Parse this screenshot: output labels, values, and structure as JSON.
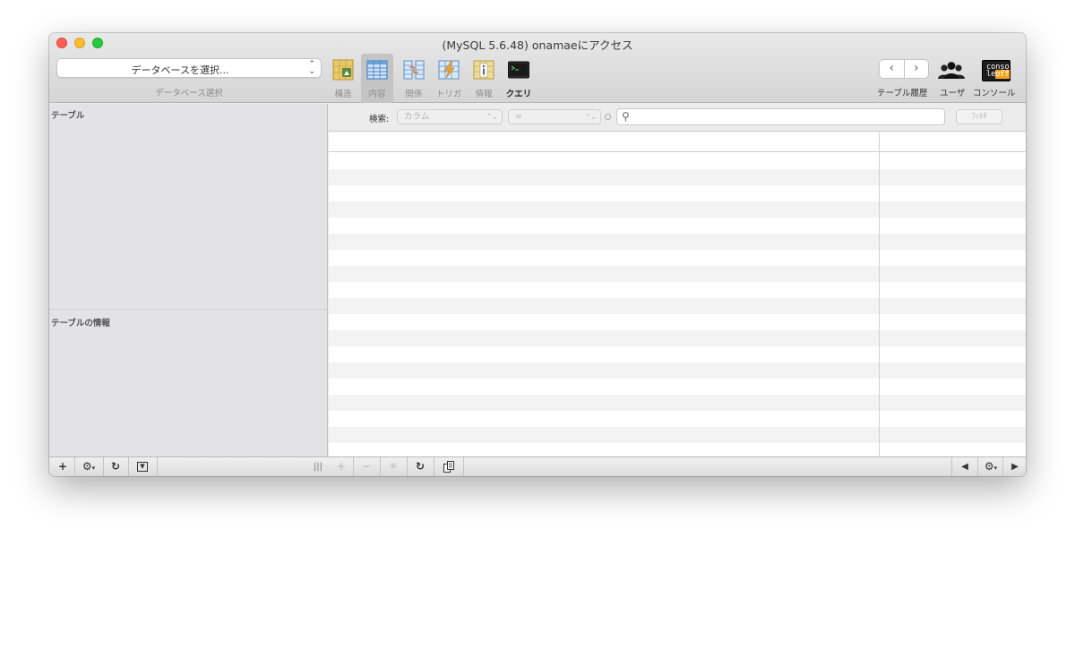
{
  "window": {
    "title": "(MySQL 5.6.48) onamaeにアクセス"
  },
  "toolbar": {
    "database_select_value": "データベースを選択...",
    "database_select_caption": "データベース選択",
    "buttons": [
      {
        "label": "構造",
        "icon": "structure-icon"
      },
      {
        "label": "内容",
        "icon": "content-table-icon",
        "active": true
      },
      {
        "label": "関係",
        "icon": "relations-icon"
      },
      {
        "label": "トリガ",
        "icon": "triggers-icon"
      },
      {
        "label": "情報",
        "icon": "info-icon"
      },
      {
        "label": "クエリ",
        "icon": "terminal-icon"
      }
    ],
    "history_label": "テーブル履歴",
    "users_label": "ユーザ",
    "console_label": "コンソール",
    "console_icon_text_top": "conso",
    "console_icon_text_bottom": "le",
    "console_icon_text_accent": "off"
  },
  "sidebar": {
    "tables_header": "テーブル",
    "table_info_header": "テーブルの情報"
  },
  "filter": {
    "search_label": "検索:",
    "column_popup": "カラム",
    "operator_popup": "=",
    "filter_button": "ﾌｨﾙﾀ"
  },
  "colors": {
    "close": "#fe5f57",
    "minimize": "#febc2e",
    "zoom": "#28c840",
    "row_stripe": "#f3f3f3",
    "console_accent": "#f5a623"
  }
}
